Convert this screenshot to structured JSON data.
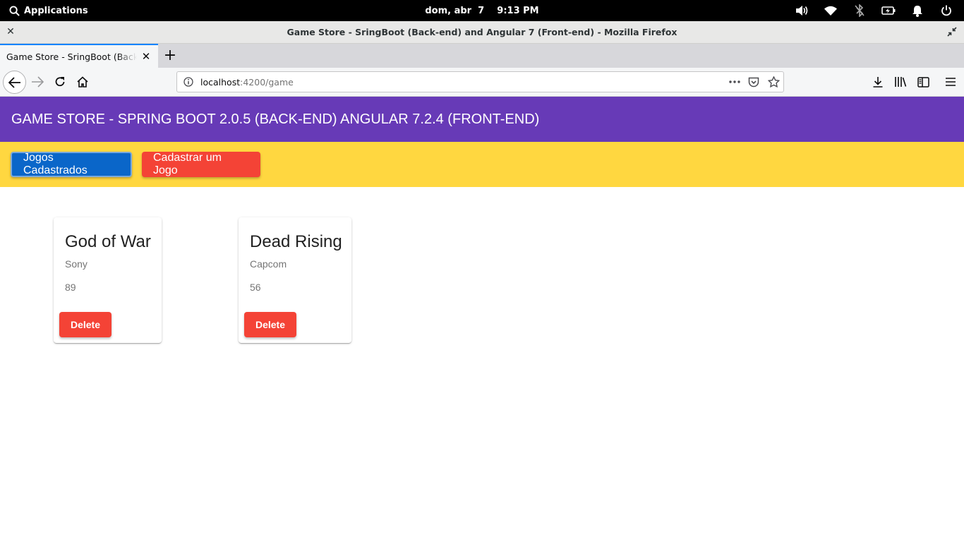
{
  "system": {
    "applications": "Applications",
    "clock": "dom, abr  7    9:13 PM"
  },
  "window": {
    "title": "Game Store - SringBoot (Back-end) and Angular 7 (Front-end) - Mozilla Firefox"
  },
  "browser": {
    "tab_title": "Game Store - SringBoot (Back-end) and Angular 7 (Front-end)",
    "url_host": "localhost",
    "url_path": ":4200/game"
  },
  "app": {
    "header": "GAME STORE - SPRING BOOT 2.0.5 (BACK-END) ANGULAR 7.2.4 (FRONT-END)",
    "nav": {
      "list_label": "Jogos Cadastrados",
      "create_label": "Cadastrar um Jogo"
    },
    "games": [
      {
        "title": "God of War",
        "publisher": "Sony",
        "score": "89",
        "delete_label": "Delete"
      },
      {
        "title": "Dead Rising",
        "publisher": "Capcom",
        "score": "56",
        "delete_label": "Delete"
      }
    ]
  },
  "colors": {
    "toolbar": "#673ab7",
    "nav_strip": "#ffd740",
    "primary_button": "#0a66c9",
    "warn_button": "#f44336"
  }
}
